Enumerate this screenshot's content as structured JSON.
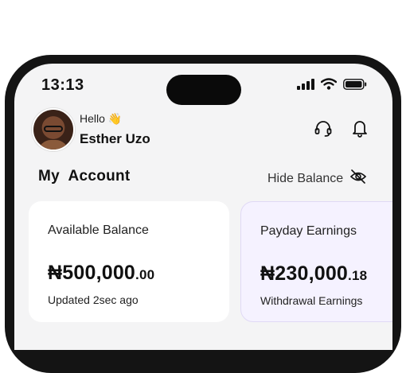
{
  "status_bar": {
    "time": "13:13"
  },
  "header": {
    "greeting": "Hello",
    "wave_emoji": "👋",
    "user_name": "Esther Uzo",
    "icons": [
      "headset-icon",
      "bell-icon"
    ]
  },
  "account": {
    "title": "My  Account",
    "hide_balance_label": "Hide Balance"
  },
  "cards": [
    {
      "label": "Available Balance",
      "amount_main": "₦500,000",
      "amount_decimal": ".00",
      "subtext": "Updated 2sec ago",
      "background": "#ffffff"
    },
    {
      "label": "Payday Earnings",
      "amount_main": "₦230,000",
      "amount_decimal": ".18",
      "subtext": "Withdrawal Earnings",
      "background": "#f5f2ff"
    }
  ]
}
